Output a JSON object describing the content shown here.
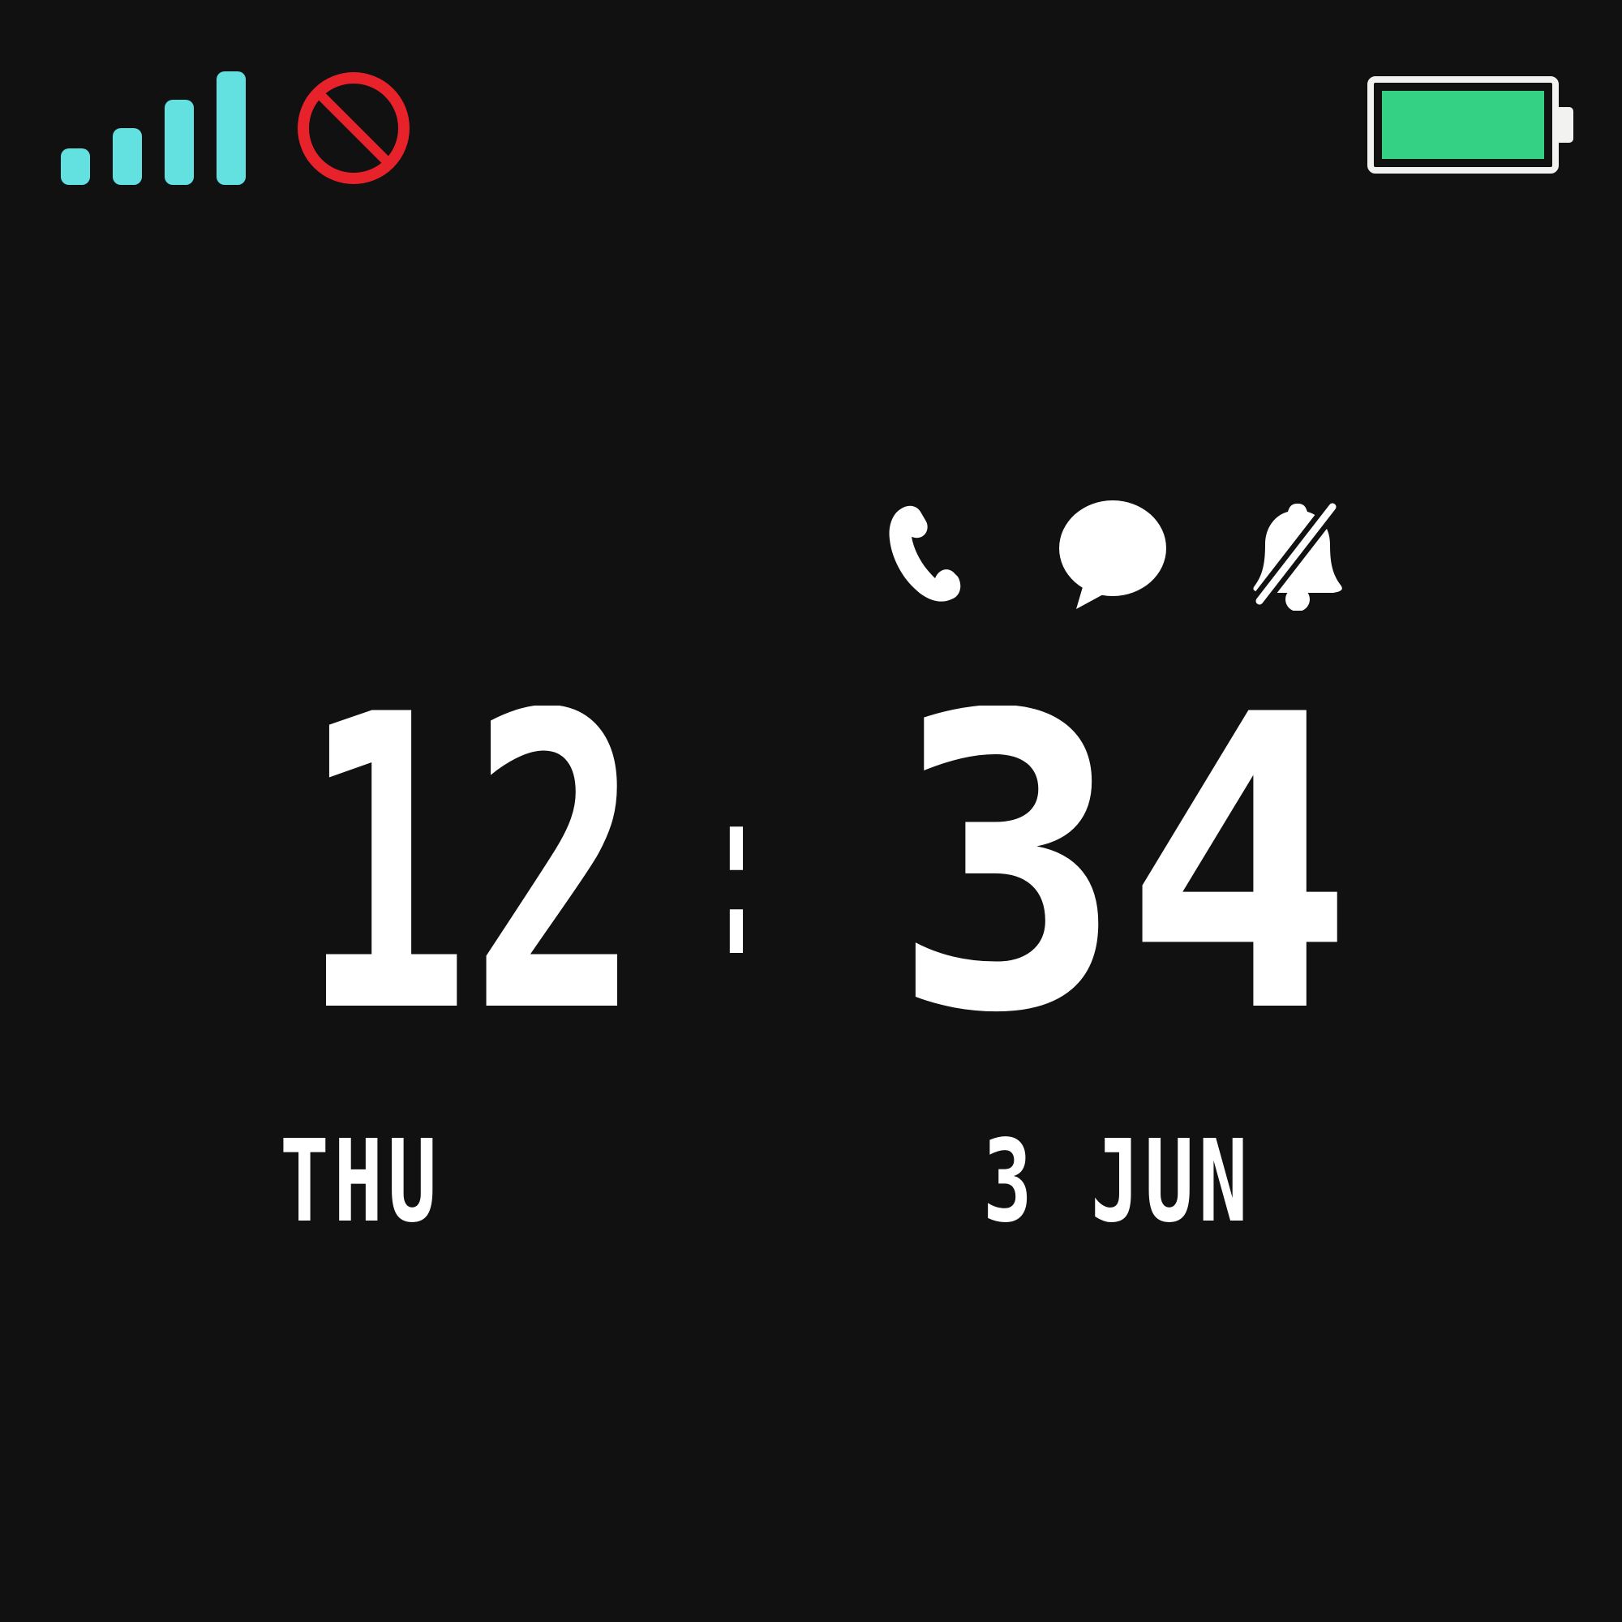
{
  "status_bar": {
    "signal": {
      "icon": "signal-strength-icon",
      "bars": 4,
      "color": "#62E1E0"
    },
    "no_service": {
      "icon": "no-service-icon",
      "color": "#E8222B"
    },
    "battery": {
      "icon": "battery-icon",
      "level": 1.0,
      "fill_color": "#34D184",
      "outline_color": "#F2F2F0"
    }
  },
  "notifications": [
    {
      "id": "call",
      "icon": "phone-icon"
    },
    {
      "id": "message",
      "icon": "chat-bubble-icon"
    },
    {
      "id": "alarm",
      "icon": "bell-off-icon"
    }
  ],
  "clock": {
    "hours": "12",
    "separator": ":",
    "minutes": "34"
  },
  "date": {
    "weekday": "THU",
    "day_month": "3 JUN"
  },
  "colors": {
    "background": "#111111",
    "foreground": "#FFFFFF"
  }
}
